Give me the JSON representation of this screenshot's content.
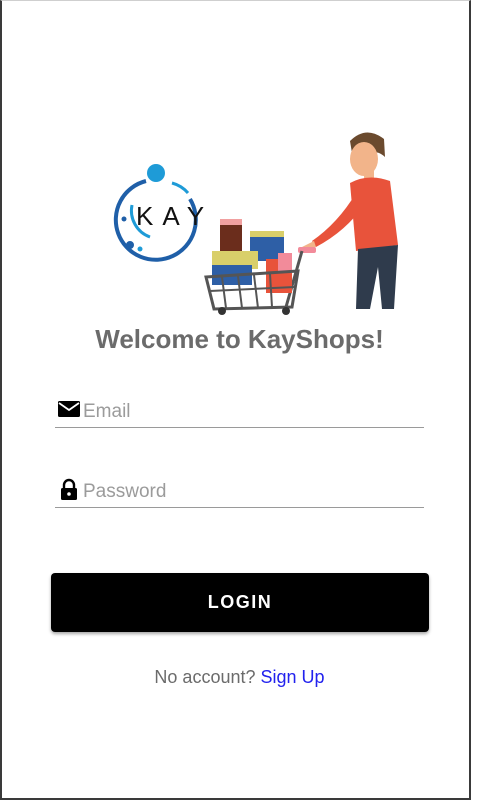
{
  "brand": {
    "logo_text": "KAY"
  },
  "welcome": {
    "title": "Welcome to KayShops!"
  },
  "form": {
    "email": {
      "placeholder": "Email",
      "value": "",
      "icon": "envelope-icon"
    },
    "password": {
      "placeholder": "Password",
      "value": "",
      "icon": "lock-icon"
    },
    "login_label": "LOGIN"
  },
  "signup": {
    "prompt": "No account?",
    "link_label": "Sign Up"
  },
  "colors": {
    "accent": "#000000",
    "link": "#2222ee",
    "title_gray": "#6b6b6b",
    "logo_blue": "#1f5fa8",
    "logo_cyan": "#1e9bd7"
  }
}
